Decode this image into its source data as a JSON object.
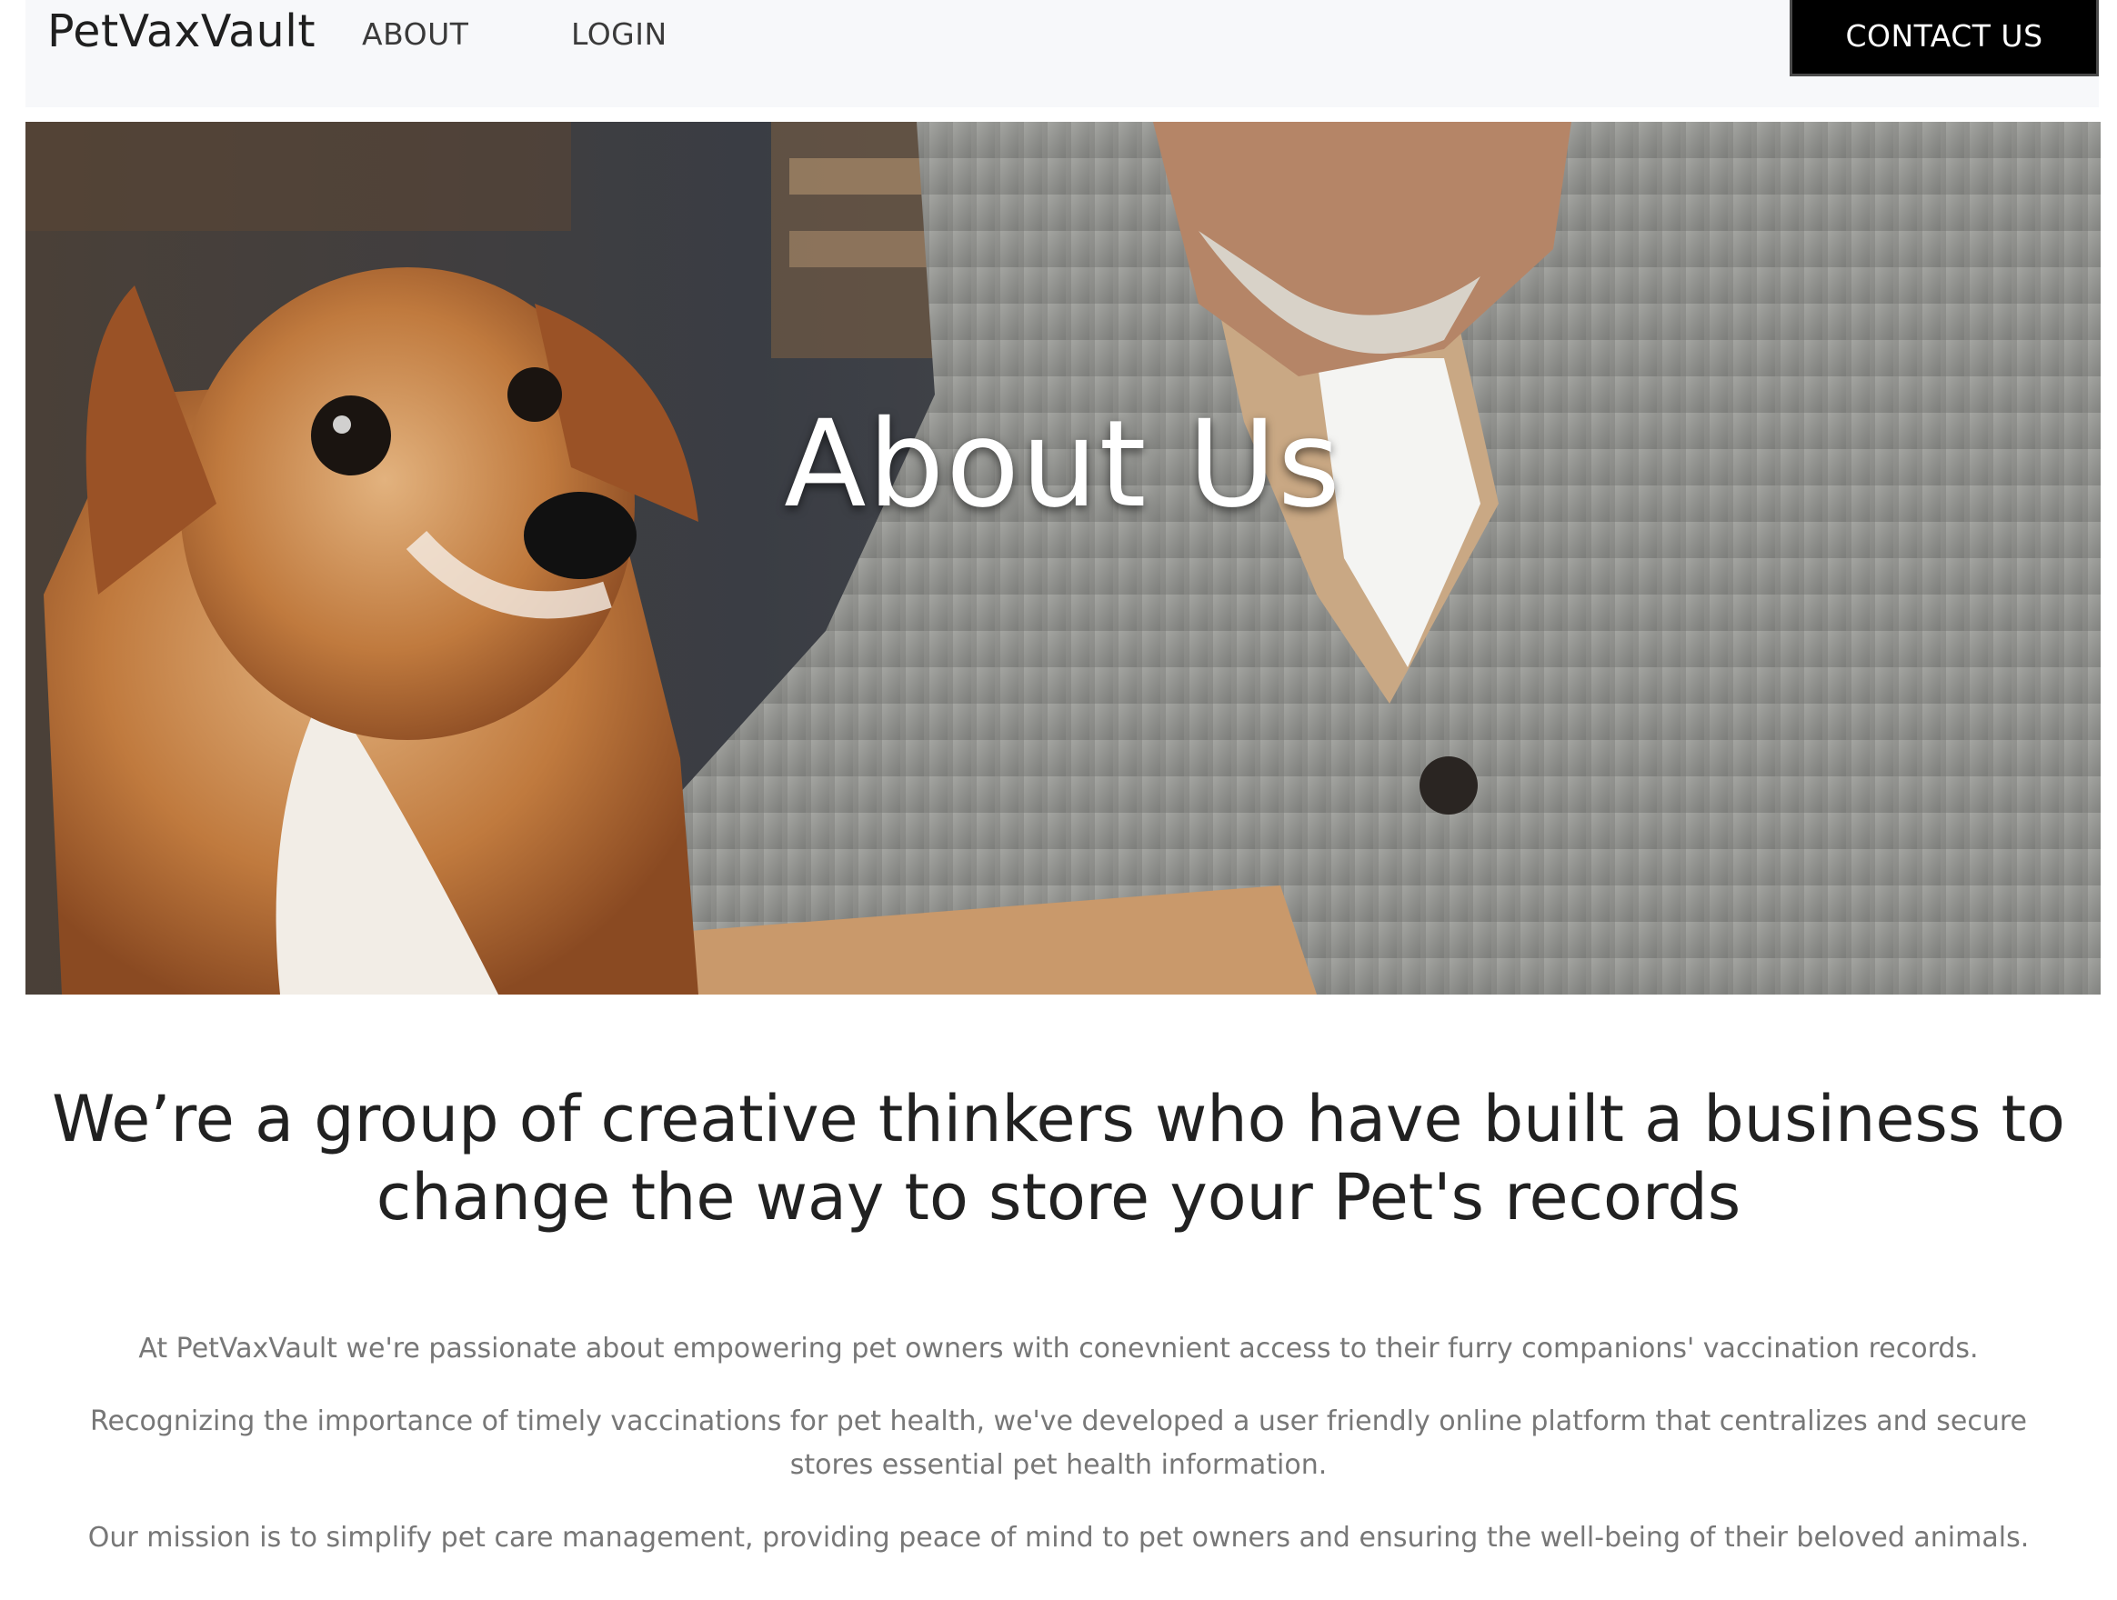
{
  "nav": {
    "brand": "PetVaxVault",
    "links": [
      {
        "label": "ABOUT"
      },
      {
        "label": "LOGIN"
      }
    ],
    "contact_label": "CONTACT US"
  },
  "hero": {
    "title": "About Us"
  },
  "content": {
    "headline": "We’re a group of creative thinkers who have built a business to change the way to store your Pet's records",
    "paragraphs": [
      "At PetVaxVault we're passionate about empowering pet owners with conevnient access to their furry companions' vaccination records.",
      "Recognizing the importance of timely vaccinations for pet health, we've developed a user friendly online platform that centralizes and secure stores essential pet health information.",
      "Our mission is to simplify pet care management, providing peace of mind to pet owners and ensuring the well-being of their beloved animals."
    ]
  },
  "colors": {
    "navbar_bg": "#f7f8fa",
    "button_bg": "#000000",
    "headline": "#212121",
    "body_text": "#777777"
  }
}
